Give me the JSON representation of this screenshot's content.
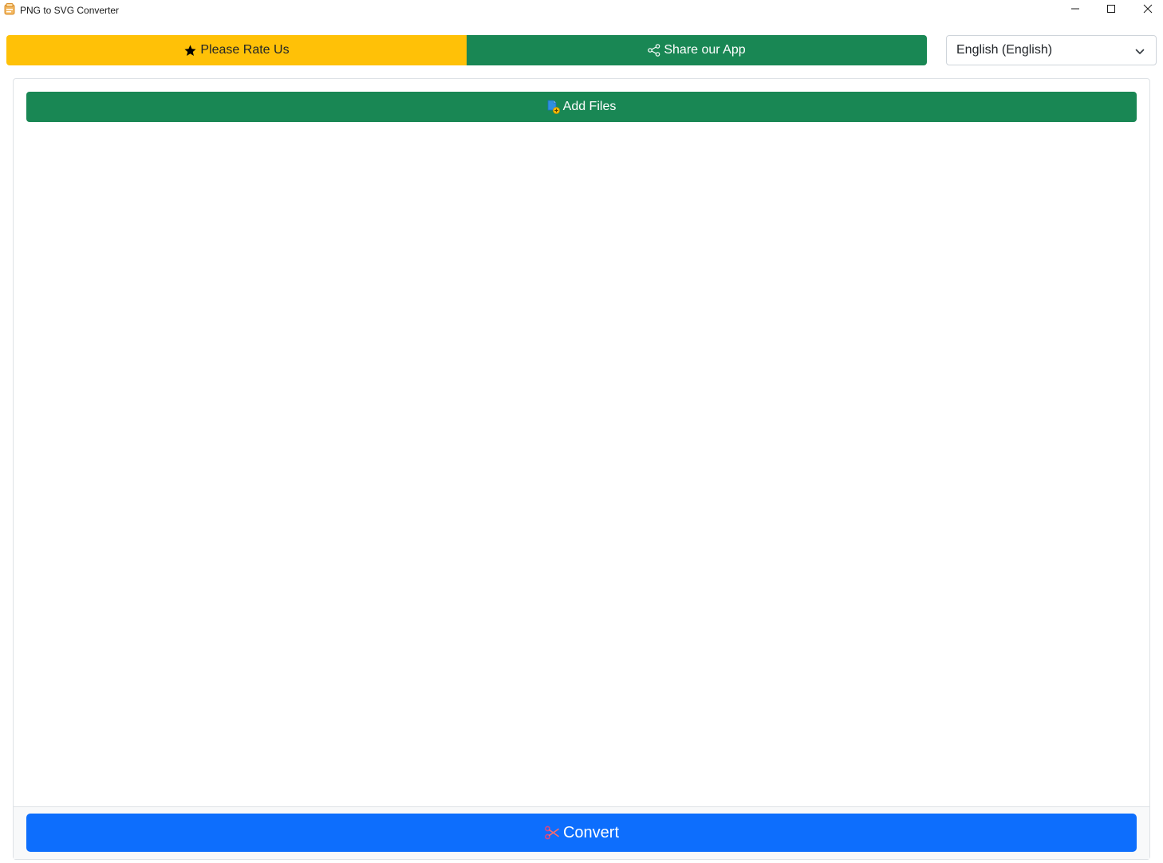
{
  "window": {
    "title": "PNG to SVG Converter",
    "icons": {
      "app": "app-icon",
      "minimize": "minimize-icon",
      "maximize": "maximize-icon",
      "close": "close-icon"
    }
  },
  "toolbar": {
    "rate_label": "Please Rate Us",
    "rate_icon": "star-icon",
    "share_label": "Share our App",
    "share_icon": "share-icon",
    "language_selected": "English (English)"
  },
  "main": {
    "add_files_label": "Add Files",
    "add_files_icon": "add-file-icon",
    "convert_label": "Convert",
    "convert_icon": "scissors-icon"
  },
  "colors": {
    "rate": "#ffc107",
    "share": "#198754",
    "add_files": "#198754",
    "convert": "#0d6efd"
  }
}
